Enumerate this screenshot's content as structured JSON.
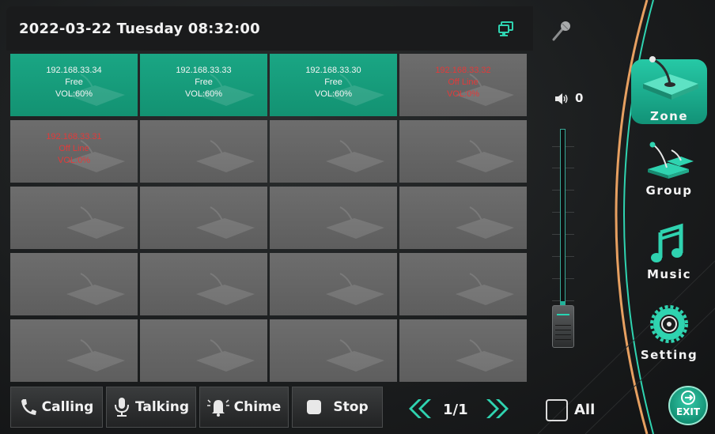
{
  "header": {
    "datetime": "2022-03-22 Tuesday 08:32:00",
    "network_icon": "network-computer-icon",
    "mic_icon": "microphone-icon"
  },
  "zones": [
    {
      "line1": "192.168.33.34",
      "line2": "Free",
      "line3": "VOL:60%",
      "status": "free"
    },
    {
      "line1": "192.168.33.33",
      "line2": "Free",
      "line3": "VOL:60%",
      "status": "free"
    },
    {
      "line1": "192.168.33.30",
      "line2": "Free",
      "line3": "VOL:60%",
      "status": "free"
    },
    {
      "line1": "192.168.33.32",
      "line2": "Off Line",
      "line3": "VOL:0%",
      "status": "offline"
    },
    {
      "line1": "192.168.33.31",
      "line2": "Off Line",
      "line3": "VOL:0%",
      "status": "offline"
    },
    {
      "line1": "",
      "line2": "",
      "line3": "",
      "status": "empty"
    },
    {
      "line1": "",
      "line2": "",
      "line3": "",
      "status": "empty"
    },
    {
      "line1": "",
      "line2": "",
      "line3": "",
      "status": "empty"
    },
    {
      "line1": "",
      "line2": "",
      "line3": "",
      "status": "empty"
    },
    {
      "line1": "",
      "line2": "",
      "line3": "",
      "status": "empty"
    },
    {
      "line1": "",
      "line2": "",
      "line3": "",
      "status": "empty"
    },
    {
      "line1": "",
      "line2": "",
      "line3": "",
      "status": "empty"
    },
    {
      "line1": "",
      "line2": "",
      "line3": "",
      "status": "empty"
    },
    {
      "line1": "",
      "line2": "",
      "line3": "",
      "status": "empty"
    },
    {
      "line1": "",
      "line2": "",
      "line3": "",
      "status": "empty"
    },
    {
      "line1": "",
      "line2": "",
      "line3": "",
      "status": "empty"
    },
    {
      "line1": "",
      "line2": "",
      "line3": "",
      "status": "empty"
    },
    {
      "line1": "",
      "line2": "",
      "line3": "",
      "status": "empty"
    },
    {
      "line1": "",
      "line2": "",
      "line3": "",
      "status": "empty"
    },
    {
      "line1": "",
      "line2": "",
      "line3": "",
      "status": "empty"
    }
  ],
  "volume": {
    "value": "0",
    "level": 0.2,
    "icon": "speaker-icon"
  },
  "nav": {
    "zone": "Zone",
    "group": "Group",
    "music": "Music",
    "setting": "Setting",
    "active": "Zone"
  },
  "toolbar": {
    "calling": "Calling",
    "talking": "Talking",
    "chime": "Chime",
    "stop": "Stop",
    "page": "1/1",
    "all": "All",
    "exit": "EXIT"
  },
  "colors": {
    "accent": "#1aa684",
    "offline_text": "#e23a3a",
    "arc_orange": "#e7a061",
    "arc_teal": "#2fd3b0"
  }
}
